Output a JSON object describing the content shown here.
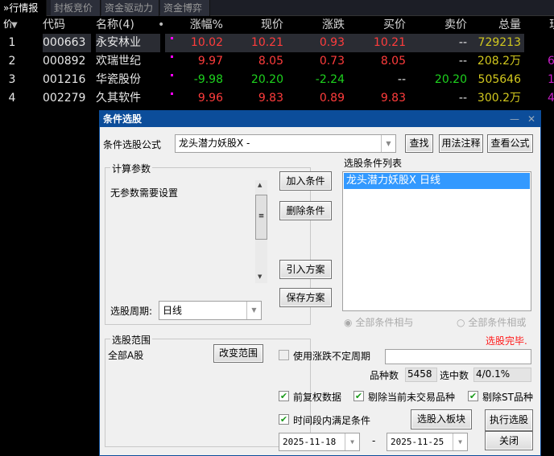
{
  "tabs": [
    "»行情报价",
    "封板竞价",
    "资金驱动力",
    "资金博弈"
  ],
  "table": {
    "headers": [
      "▼",
      "代码",
      "名称(4)",
      "•",
      "涨幅%",
      "现价",
      "涨跌",
      "买价",
      "卖价",
      "总量",
      "现"
    ],
    "rows": [
      {
        "idx": "1",
        "code": "000663",
        "name": "永安林业",
        "pct": "10.02",
        "price": "10.21",
        "chg": "0.93",
        "bid": "10.21",
        "ask": "--",
        "vol": "729213",
        "extra": ""
      },
      {
        "idx": "2",
        "code": "000892",
        "name": "欢瑞世纪",
        "pct": "9.97",
        "price": "8.05",
        "chg": "0.73",
        "bid": "8.05",
        "ask": "--",
        "vol": "208.2万",
        "extra": "6"
      },
      {
        "idx": "3",
        "code": "001216",
        "name": "华瓷股份",
        "pct": "-9.98",
        "price": "20.20",
        "chg": "-2.24",
        "bid": "--",
        "ask": "20.20",
        "vol": "505646",
        "extra": "1"
      },
      {
        "idx": "4",
        "code": "002279",
        "name": "久其软件",
        "pct": "9.96",
        "price": "9.83",
        "chg": "0.89",
        "bid": "9.83",
        "ask": "--",
        "vol": "300.2万",
        "extra": "4"
      }
    ]
  },
  "dialog": {
    "title": "条件选股",
    "minimize": "—",
    "close": "✕",
    "formula_label": "条件选股公式",
    "formula_value": "龙头潜力妖股X  -",
    "find": "查找",
    "usage": "用法注释",
    "view_formula": "查看公式",
    "params_group": "计算参数",
    "params_text": "无参数需要设置",
    "period_label": "选股周期:",
    "period_value": "日线",
    "add": "加入条件",
    "delete": "删除条件",
    "import": "引入方案",
    "save": "保存方案",
    "list_label": "选股条件列表",
    "list_items": [
      "龙头潜力妖股X  日线"
    ],
    "radio_and": "全部条件相与",
    "radio_or": "全部条件相或",
    "status": "选股完毕.",
    "range_group": "选股范围",
    "range_value": "全部A股",
    "change_range": "改变范围",
    "use_period": "使用涨跌不定周期",
    "count_label": "品种数",
    "count_value": "5458",
    "selected_label": "选中数",
    "selected_value": "4/0.1%",
    "fq": "前复权数据",
    "exclude_untraded": "剔除当前未交易品种",
    "exclude_st": "剔除ST品种",
    "time_range": "时间段内满足条件",
    "to_block": "选股入板块",
    "execute": "执行选股",
    "close_btn": "关闭",
    "date_from": "2025-11-18",
    "dash": "-",
    "date_to": "2025-11-25"
  }
}
